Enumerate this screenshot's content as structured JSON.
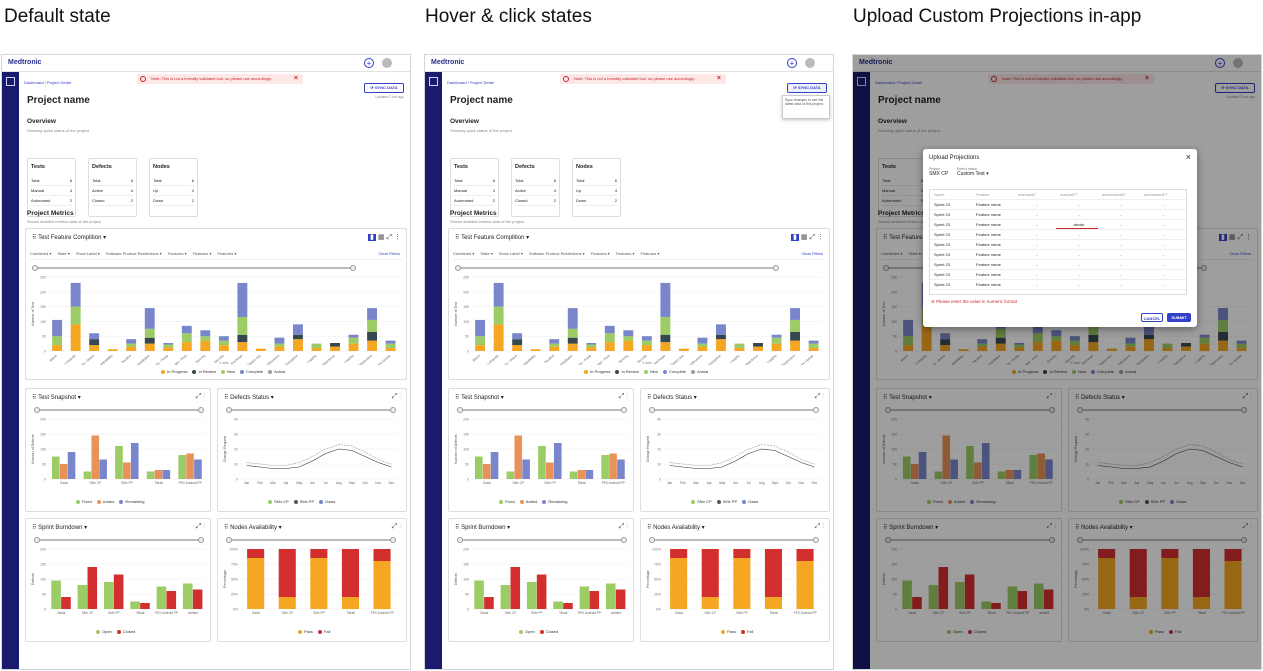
{
  "headings": [
    "Default state",
    "Hover & click states",
    "Upload Custom Projections in-app"
  ],
  "app": {
    "brand": "Medtronic",
    "breadcrumb": "Dashboard / Project Detail",
    "warning": "Note: This is not a formally validated tool, so please use accordingly.",
    "sync_label": "SYNC DATA",
    "updated": "Updated 2 hrs ago",
    "sync_tooltip": "Sync changes to see the latest data of this project.",
    "project_title": "Project name",
    "overview_title": "Overview",
    "overview_sub": "Showing quick status of the project",
    "metrics_title": "Project Metrics",
    "metrics_sub": "Shows detailed metrics data of the project"
  },
  "cards": [
    {
      "title": "Tests",
      "rows": [
        [
          "Total",
          "6"
        ],
        [
          "Manual",
          "4"
        ],
        [
          "Automated",
          "2"
        ]
      ]
    },
    {
      "title": "Defects",
      "rows": [
        [
          "Total",
          "6"
        ],
        [
          "Active",
          "4"
        ],
        [
          "Closed",
          "2"
        ]
      ]
    },
    {
      "title": "Nodes",
      "rows": [
        [
          "Total",
          "6"
        ],
        [
          "Up",
          "4"
        ],
        [
          "Down",
          "2"
        ]
      ]
    }
  ],
  "feature_panel": {
    "title": "Test Feature Complition",
    "filters": [
      "Combined",
      "State",
      "Show Label",
      "Software Product Restrictions",
      "Features",
      "Features",
      "Features"
    ],
    "clear": "Clear Filters",
    "xlabel": "X axis",
    "ylabel": "Number of Test"
  },
  "snapshot_title": "Test Snapshot",
  "defects_title": "Defects Status",
  "burndown_title": "Sprint Burndown",
  "nodes_title": "Nodes Availability",
  "modal": {
    "title": "Upload Projections",
    "project_label": "Project",
    "project_value": "SMX CP",
    "metric_label": "Select metric",
    "metric_value": "Custom Test",
    "columns": [
      "Sprint",
      "Feature",
      "manualAT",
      "manualFT",
      "automatedAT",
      "automatedFT"
    ],
    "row_sprint": "Sprint 23",
    "row_feature": "Feature name",
    "dash": "-",
    "edit_value": "abcde",
    "error": "Please enter the value in numeric format",
    "cancel": "CANCEL",
    "submit": "SUBMIT"
  },
  "chart_data": [
    {
      "type": "bar",
      "title": "Test Feature Complition",
      "xlabel": "X axis",
      "ylabel": "Number of Test",
      "ylim": [
        0,
        250
      ],
      "yticks": [
        0,
        50,
        100,
        150,
        200,
        250
      ],
      "categories": [
        "Attach",
        "Battery - Longevity",
        "Battery - Status",
        "Compatibility",
        "Nautilus",
        "Installation",
        "Therapy - Pump",
        "Therapy - Perp",
        "Syncing",
        "Security",
        "Recharge",
        "Patient Info",
        "Notifications",
        "Navigation",
        "Logging",
        "Impedance",
        "Logging",
        "Diagnostics",
        "Firmware Update"
      ],
      "series": [
        {
          "name": "In Progress",
          "color": "#f5a623",
          "values": [
            20,
            90,
            20,
            6,
            15,
            25,
            12,
            30,
            35,
            20,
            30,
            8,
            15,
            40,
            10,
            15,
            25,
            35,
            10
          ]
        },
        {
          "name": "In Review",
          "color": "#37474f",
          "values": [
            0,
            0,
            20,
            0,
            0,
            20,
            0,
            0,
            0,
            0,
            25,
            0,
            0,
            15,
            0,
            12,
            0,
            30,
            0
          ]
        },
        {
          "name": "New",
          "color": "#9ccc65",
          "values": [
            30,
            60,
            0,
            0,
            10,
            30,
            10,
            30,
            15,
            15,
            60,
            0,
            10,
            0,
            15,
            0,
            20,
            40,
            15
          ]
        },
        {
          "name": "Complete",
          "color": "#7986cb",
          "values": [
            55,
            80,
            20,
            0,
            15,
            70,
            5,
            25,
            20,
            15,
            115,
            0,
            20,
            35,
            0,
            0,
            10,
            40,
            10
          ]
        },
        {
          "name": "Actual",
          "color": "#9e9e9e",
          "values": [
            0,
            0,
            0,
            0,
            0,
            0,
            0,
            0,
            0,
            0,
            0,
            0,
            0,
            0,
            0,
            0,
            0,
            0,
            0
          ]
        }
      ]
    },
    {
      "type": "bar",
      "title": "Test Snapshot",
      "ylabel": "Number of Defects",
      "ylim": [
        0,
        200
      ],
      "yticks": [
        0,
        50,
        100,
        150,
        200
      ],
      "categories": [
        "Oasis",
        "SMx CP",
        "SMx PP",
        "Tiltrail",
        "PEX Android PP"
      ],
      "series": [
        {
          "name": "Fixed",
          "color": "#9ccc65",
          "values": [
            75,
            25,
            110,
            25,
            80
          ]
        },
        {
          "name": "Added",
          "color": "#e8925a",
          "values": [
            50,
            145,
            55,
            30,
            85
          ]
        },
        {
          "name": "Remaining",
          "color": "#7986cb",
          "values": [
            90,
            65,
            120,
            30,
            65
          ]
        }
      ]
    },
    {
      "type": "line",
      "title": "Defects Status",
      "ylabel": "Change Request",
      "ylim": [
        0,
        40
      ],
      "yticks": [
        0,
        10,
        20,
        30,
        40
      ],
      "categories": [
        "Jan",
        "Feb",
        "Mar",
        "Apr",
        "May",
        "Jun",
        "Jul",
        "Aug",
        "Sept",
        "Oct",
        "Nov",
        "Dec"
      ],
      "series": [
        {
          "name": "SMx CP",
          "color": "#9ccc65",
          "values": [
            11,
            10,
            9,
            9,
            11,
            15,
            20,
            23,
            22,
            18,
            13,
            10
          ]
        },
        {
          "name": "SMx PP",
          "color": "#555555",
          "values": [
            9,
            8,
            7,
            7,
            8,
            12,
            17,
            20,
            19,
            15,
            11,
            8
          ]
        },
        {
          "name": "Oasis",
          "color": "#7986cb",
          "values": [
            11,
            10,
            9,
            9,
            11,
            15,
            20,
            23,
            22,
            18,
            13,
            10
          ]
        }
      ]
    },
    {
      "type": "bar",
      "title": "Sprint Burndown",
      "ylabel": "Defects",
      "ylim": [
        0,
        200
      ],
      "yticks": [
        0,
        50,
        100,
        150,
        200
      ],
      "categories": [
        "Oasis",
        "SMx CP",
        "SMx PP",
        "Tiltrail",
        "PEX Android PP",
        "untitled"
      ],
      "series": [
        {
          "name": "Open",
          "color": "#9ccc65",
          "values": [
            95,
            80,
            90,
            25,
            75,
            85
          ]
        },
        {
          "name": "Closed",
          "color": "#d32f2f",
          "values": [
            40,
            140,
            115,
            20,
            60,
            65
          ]
        }
      ]
    },
    {
      "type": "bar",
      "title": "Nodes Availability",
      "ylabel": "Percentage",
      "ylim": [
        0,
        100
      ],
      "yticks": [
        "0%",
        "25%",
        "50%",
        "75%",
        "100%"
      ],
      "categories": [
        "Oasis",
        "SMx CP",
        "SMx PP",
        "Tiltrail",
        "PEX Android PP"
      ],
      "series": [
        {
          "name": "Pass",
          "color": "#f5a623",
          "values": [
            85,
            20,
            85,
            20,
            80
          ]
        },
        {
          "name": "Fail",
          "color": "#d32f2f",
          "values": [
            15,
            80,
            15,
            80,
            20
          ]
        }
      ]
    }
  ]
}
